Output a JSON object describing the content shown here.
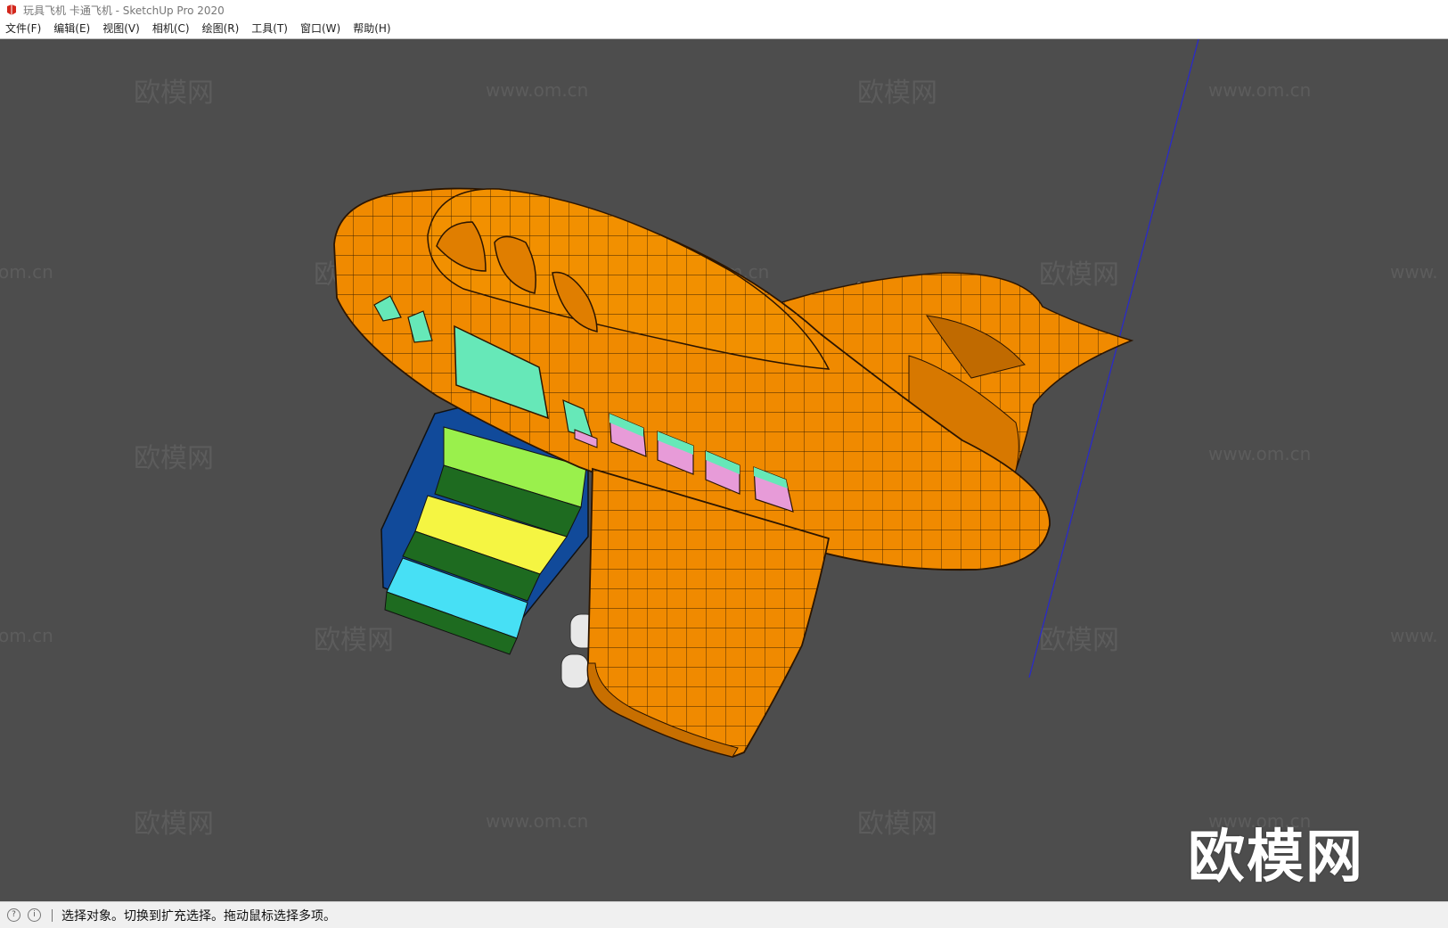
{
  "window": {
    "title": "玩具飞机 卡通飞机 - SketchUp Pro 2020",
    "icon": "sketchup-logo-icon"
  },
  "menu": [
    {
      "label": "文件(F)"
    },
    {
      "label": "编辑(E)"
    },
    {
      "label": "视图(V)"
    },
    {
      "label": "相机(C)"
    },
    {
      "label": "绘图(R)"
    },
    {
      "label": "工具(T)"
    },
    {
      "label": "窗口(W)"
    },
    {
      "label": "帮助(H)"
    }
  ],
  "viewport": {
    "background": "#4d4d4d",
    "model": "cartoon-toy-airplane",
    "body_color": "#f08a00",
    "window_color": "#66e8b8",
    "watermark_logo": "欧模网",
    "watermark_url": "www.om.cn"
  },
  "statusbar": {
    "icons": [
      "geo-location-icon",
      "info-icon"
    ],
    "message": "选择对象。切换到扩充选择。拖动鼠标选择多项。"
  }
}
